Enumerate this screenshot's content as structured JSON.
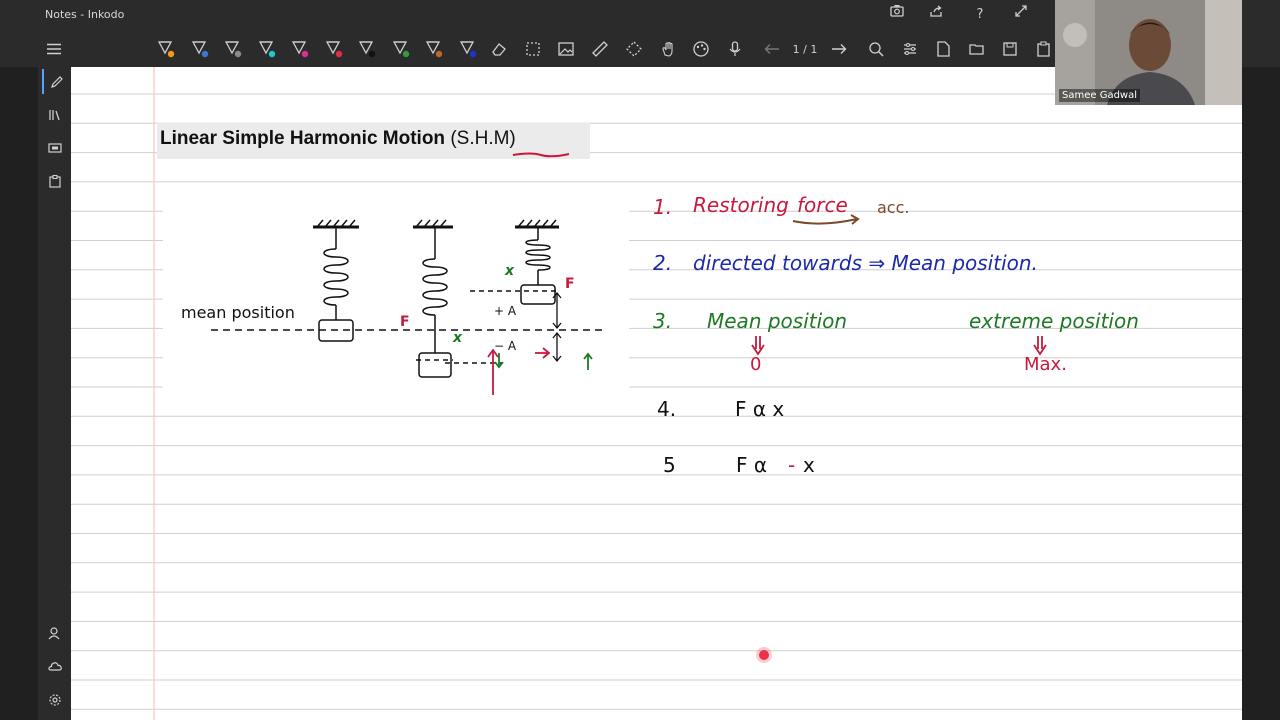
{
  "window": {
    "title": "Notes - Inkodo"
  },
  "titlebar_buttons": [
    "screenshot-icon",
    "share-icon",
    "help-icon",
    "fullscreen-icon"
  ],
  "toolbar": {
    "menu_icon": "hamburger-icon",
    "pens": [
      {
        "name": "pen-orange",
        "color": "#f39c12"
      },
      {
        "name": "pen-blue",
        "color": "#3a78d8"
      },
      {
        "name": "pen-gray",
        "color": "#8a8a8a"
      },
      {
        "name": "pen-cyan",
        "color": "#1ec8d0"
      },
      {
        "name": "pen-magenta",
        "color": "#e02b9a"
      },
      {
        "name": "pen-red",
        "color": "#e03040"
      },
      {
        "name": "pen-black",
        "color": "#111111"
      },
      {
        "name": "pen-green",
        "color": "#2e9d3a"
      },
      {
        "name": "pen-brown",
        "color": "#c0652b"
      },
      {
        "name": "pen-navy",
        "color": "#2233cc"
      }
    ],
    "tools": [
      "eraser-icon",
      "select-icon",
      "image-icon",
      "ruler-icon",
      "lasso-icon",
      "pan-hand-icon",
      "palette-icon",
      "mic-icon"
    ],
    "page_indicator": "1 / 1",
    "right_tools": [
      "zoom-icon",
      "settings-icon",
      "new-page-icon",
      "open-folder-icon",
      "save-icon",
      "paste-icon"
    ]
  },
  "video": {
    "name": "Samee Gadwal"
  },
  "note": {
    "heading": "Linear Simple Harmonic Motion",
    "heading_abbr": "(S.H.M)",
    "diagram": {
      "mean_position_label": "mean position",
      "force_label": "F",
      "disp_label": "x",
      "plus_A": "+ A",
      "minus_A": "− A"
    },
    "points": [
      {
        "num": "1.",
        "text": "Restoring",
        "text2": "force",
        "text3": "acc."
      },
      {
        "num": "2.",
        "text": "directed towards ⇒ Mean position."
      },
      {
        "num": "3.",
        "text": "Mean position",
        "text2": "extreme position",
        "mean_val": "0",
        "ext_val": "Max."
      },
      {
        "num": "4.",
        "text": "F α x"
      },
      {
        "num": "5",
        "text_a": "F α",
        "text_b": "-",
        "text_c": "x"
      }
    ]
  },
  "left_rail": [
    "pen-mode-icon",
    "library-icon",
    "slides-icon",
    "clipboard-icon",
    "user-icon",
    "cloud-icon",
    "gear-icon"
  ],
  "colors": {
    "accent_red": "#c8193d",
    "blue": "#1c2aa8",
    "green": "#1d7a23",
    "brown": "#7a4a2a"
  }
}
